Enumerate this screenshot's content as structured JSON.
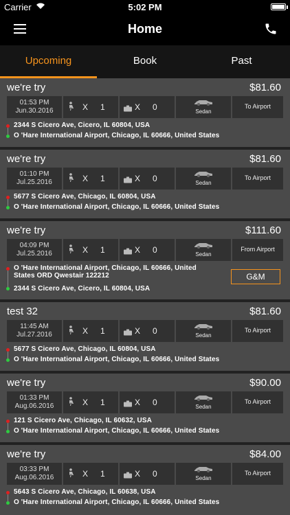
{
  "status_bar": {
    "carrier": "Carrier",
    "time": "5:02 PM"
  },
  "nav": {
    "title": "Home",
    "menu_icon": "hamburger-menu-icon",
    "phone_icon": "phone-icon"
  },
  "tabs": [
    {
      "label": "Upcoming",
      "active": true
    },
    {
      "label": "Book",
      "active": false
    },
    {
      "label": "Past",
      "active": false
    }
  ],
  "colors": {
    "accent": "#f7941d",
    "card": "#4a4a4a",
    "cell": "#313131",
    "pickup_dot": "#e02020",
    "dropoff_dot": "#2ecc40"
  },
  "trips": [
    {
      "name": "we're try",
      "price": "$81.60",
      "time": "01:53 PM",
      "date": "Jun.30.2016",
      "passengers_x": "X",
      "passengers": "1",
      "luggage_x": "X",
      "luggage": "0",
      "vehicle": "Sedan",
      "direction": "To Airport",
      "pickup": "2344 S Cicero Ave, Cicero, IL 60804, USA",
      "dropoff": "O 'Hare International Airport, Chicago, IL 60666, United States"
    },
    {
      "name": "we're try",
      "price": "$81.60",
      "time": "01:10 PM",
      "date": "Jul.25.2016",
      "passengers_x": "X",
      "passengers": "1",
      "luggage_x": "X",
      "luggage": "0",
      "vehicle": "Sedan",
      "direction": "To Airport",
      "pickup": "5677 S Cicero Ave, Chicago, IL 60804, USA",
      "dropoff": "O 'Hare International Airport, Chicago, IL 60666, United States"
    },
    {
      "name": "we're try",
      "price": "$111.60",
      "time": "04:09 PM",
      "date": "Jul.25.2016",
      "passengers_x": "X",
      "passengers": "1",
      "luggage_x": "X",
      "luggage": "0",
      "vehicle": "Sedan",
      "direction": "From Airport",
      "pickup_line1": "O 'Hare International Airport, Chicago, IL 60666, United",
      "pickup_line2": "States ORD Qwestair 122212",
      "dropoff": "2344 S Cicero Ave, Cicero, IL 60804, USA",
      "button": "G&M"
    },
    {
      "name": "test 32",
      "price": "$81.60",
      "time": "11:45 AM",
      "date": "Jul.27.2016",
      "passengers_x": "X",
      "passengers": "1",
      "luggage_x": "X",
      "luggage": "0",
      "vehicle": "Sedan",
      "direction": "To Airport",
      "pickup": "5677 S Cicero Ave, Chicago, IL 60804, USA",
      "dropoff": "O 'Hare International Airport, Chicago, IL 60666, United States"
    },
    {
      "name": "we're try",
      "price": "$90.00",
      "time": "01:33 PM",
      "date": "Aug.06.2016",
      "passengers_x": "X",
      "passengers": "1",
      "luggage_x": "X",
      "luggage": "0",
      "vehicle": "Sedan",
      "direction": "To Airport",
      "pickup": "121 S Cicero Ave, Chicago, IL 60632, USA",
      "dropoff": "O 'Hare International Airport, Chicago, IL 60666, United States"
    },
    {
      "name": "we're try",
      "price": "$84.00",
      "time": "03:33 PM",
      "date": "Aug.06.2016",
      "passengers_x": "X",
      "passengers": "1",
      "luggage_x": "X",
      "luggage": "0",
      "vehicle": "Sedan",
      "direction": "To Airport",
      "pickup": "5643 S Cicero Ave, Chicago, IL 60638, USA",
      "dropoff": "O 'Hare International Airport, Chicago, IL 60666, United States"
    }
  ]
}
